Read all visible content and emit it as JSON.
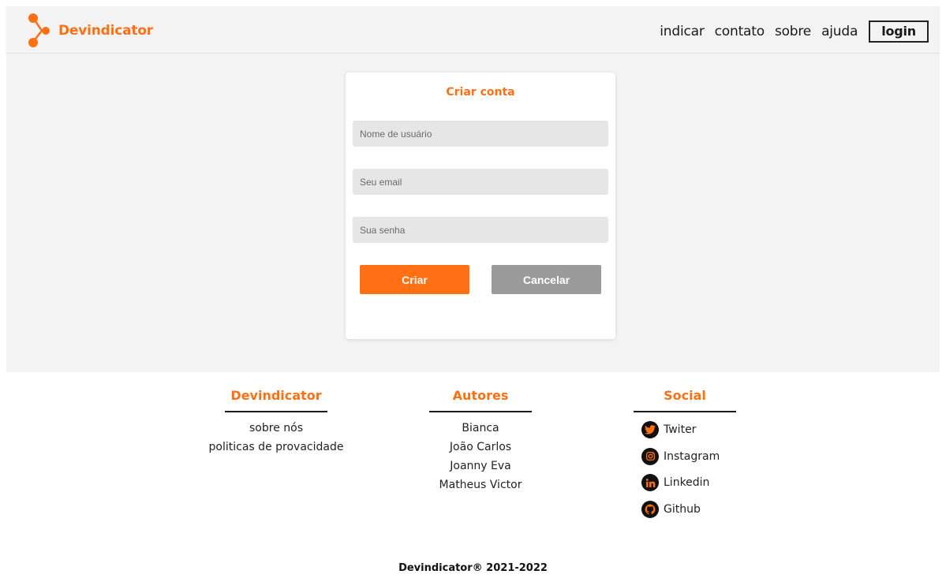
{
  "colors": {
    "accent": "#ff6f14",
    "cancel": "#9b9b9b",
    "panel": "#f3f3f3",
    "field": "#e6e6e6"
  },
  "header": {
    "logo_text": "Devindicator",
    "nav": [
      "indicar",
      "contato",
      "sobre",
      "ajuda"
    ],
    "login_label": "login"
  },
  "form": {
    "title": "Criar conta",
    "fields": {
      "username_placeholder": "Nome de usuário",
      "email_placeholder": "Seu email",
      "password_placeholder": "Sua senha"
    },
    "create_label": "Criar",
    "cancel_label": "Cancelar"
  },
  "footer": {
    "brand": {
      "title": "Devindicator",
      "links": [
        "sobre nós",
        "politicas de provacidade"
      ]
    },
    "authors": {
      "title": "Autores",
      "names": [
        "Bianca",
        "João Carlos",
        "Joanny Eva",
        "Matheus Victor"
      ]
    },
    "social": {
      "title": "Social",
      "items": [
        {
          "label": "Twiter",
          "icon": "twitter-icon"
        },
        {
          "label": "Instagram",
          "icon": "instagram-icon"
        },
        {
          "label": "Linkedin",
          "icon": "linkedin-icon"
        },
        {
          "label": "Github",
          "icon": "github-icon"
        }
      ]
    },
    "copyright": "Devindicator® 2021-2022"
  }
}
